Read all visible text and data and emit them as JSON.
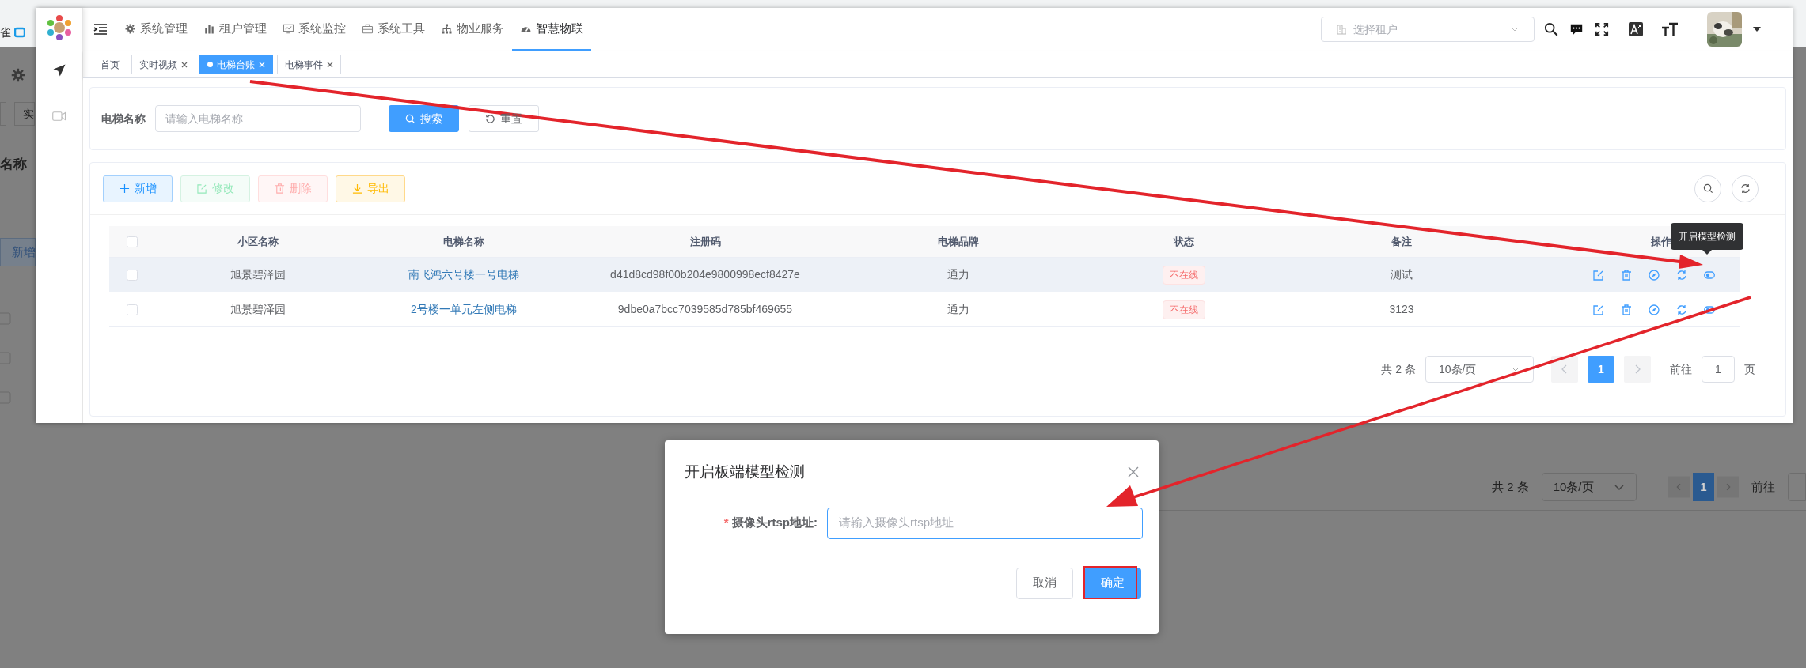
{
  "browser_bar": {
    "bookmark_fragment": "雀"
  },
  "background_page": {
    "checkboxes": [
      {
        "checked": false
      },
      {
        "checked": false
      },
      {
        "checked": false
      }
    ],
    "tab_fragment": "实",
    "label_fragment": "名称",
    "button_fragment": "新增",
    "pagination": {
      "total": "共 2 条",
      "page_size": "10条/页",
      "page": "1",
      "goto_label": "前往"
    }
  },
  "top_nav": {
    "items": [
      {
        "label": "系统管理",
        "selected": false
      },
      {
        "label": "租户管理",
        "selected": false
      },
      {
        "label": "系统监控",
        "selected": false
      },
      {
        "label": "系统工具",
        "selected": false
      },
      {
        "label": "物业服务",
        "selected": false
      },
      {
        "label": "智慧物联",
        "selected": true
      }
    ],
    "tenant_select": {
      "placeholder": "选择租户"
    }
  },
  "tabs": [
    {
      "label": "首页",
      "selected": false,
      "closable": false
    },
    {
      "label": "实时视频",
      "selected": false,
      "closable": true
    },
    {
      "label": "电梯台账",
      "selected": true,
      "closable": true
    },
    {
      "label": "电梯事件",
      "selected": false,
      "closable": true
    }
  ],
  "search_form": {
    "label": "电梯名称",
    "placeholder": "请输入电梯名称",
    "buttons": [
      {
        "label": "搜索",
        "kind": "search"
      },
      {
        "label": "重置",
        "kind": "reset"
      }
    ]
  },
  "toolbar": [
    {
      "label": "新增",
      "kind": "add",
      "disabled": false
    },
    {
      "label": "修改",
      "kind": "edit",
      "disabled": true
    },
    {
      "label": "删除",
      "kind": "delete",
      "disabled": true
    },
    {
      "label": "导出",
      "kind": "export",
      "disabled": false
    }
  ],
  "table": {
    "all_checked": false,
    "columns": [
      {
        "label": "小区名称",
        "kind": "text"
      },
      {
        "label": "电梯名称",
        "kind": "link"
      },
      {
        "label": "注册码",
        "kind": "text"
      },
      {
        "label": "电梯品牌",
        "kind": "text"
      },
      {
        "label": "状态",
        "kind": "tag"
      },
      {
        "label": "备注",
        "kind": "text"
      },
      {
        "label": "操作",
        "kind": "actions"
      }
    ],
    "rows": [
      {
        "cells": [
          "旭景碧泽园",
          "南飞鸿六号楼一号电梯",
          "d41d8cd98f00b204e9800998ecf8427e",
          "通力",
          "不在线",
          "测试"
        ],
        "hovered": true,
        "checked": false
      },
      {
        "cells": [
          "旭景碧泽园",
          "2号楼一单元左侧电梯",
          "9dbe0a7bcc7039585d785bf469655",
          "通力",
          "不在线",
          "3123"
        ],
        "hovered": false,
        "checked": false
      }
    ]
  },
  "tooltip": "开启模型检测",
  "pagination": {
    "total": "共 2 条",
    "page_size": "10条/页",
    "pages": [
      {
        "label": "1",
        "selected": true
      }
    ],
    "goto_label": "前往",
    "goto_value": "1",
    "page_unit": "页"
  },
  "dialog": {
    "title": "开启板端模型检测",
    "field": {
      "required_mark": "*",
      "label": "摄像头rtsp地址:",
      "placeholder": "请输入摄像头rtsp地址"
    },
    "buttons": [
      {
        "label": "取消",
        "kind": "default",
        "highlighted": false
      },
      {
        "label": "确定",
        "kind": "primary",
        "highlighted": true
      }
    ]
  }
}
